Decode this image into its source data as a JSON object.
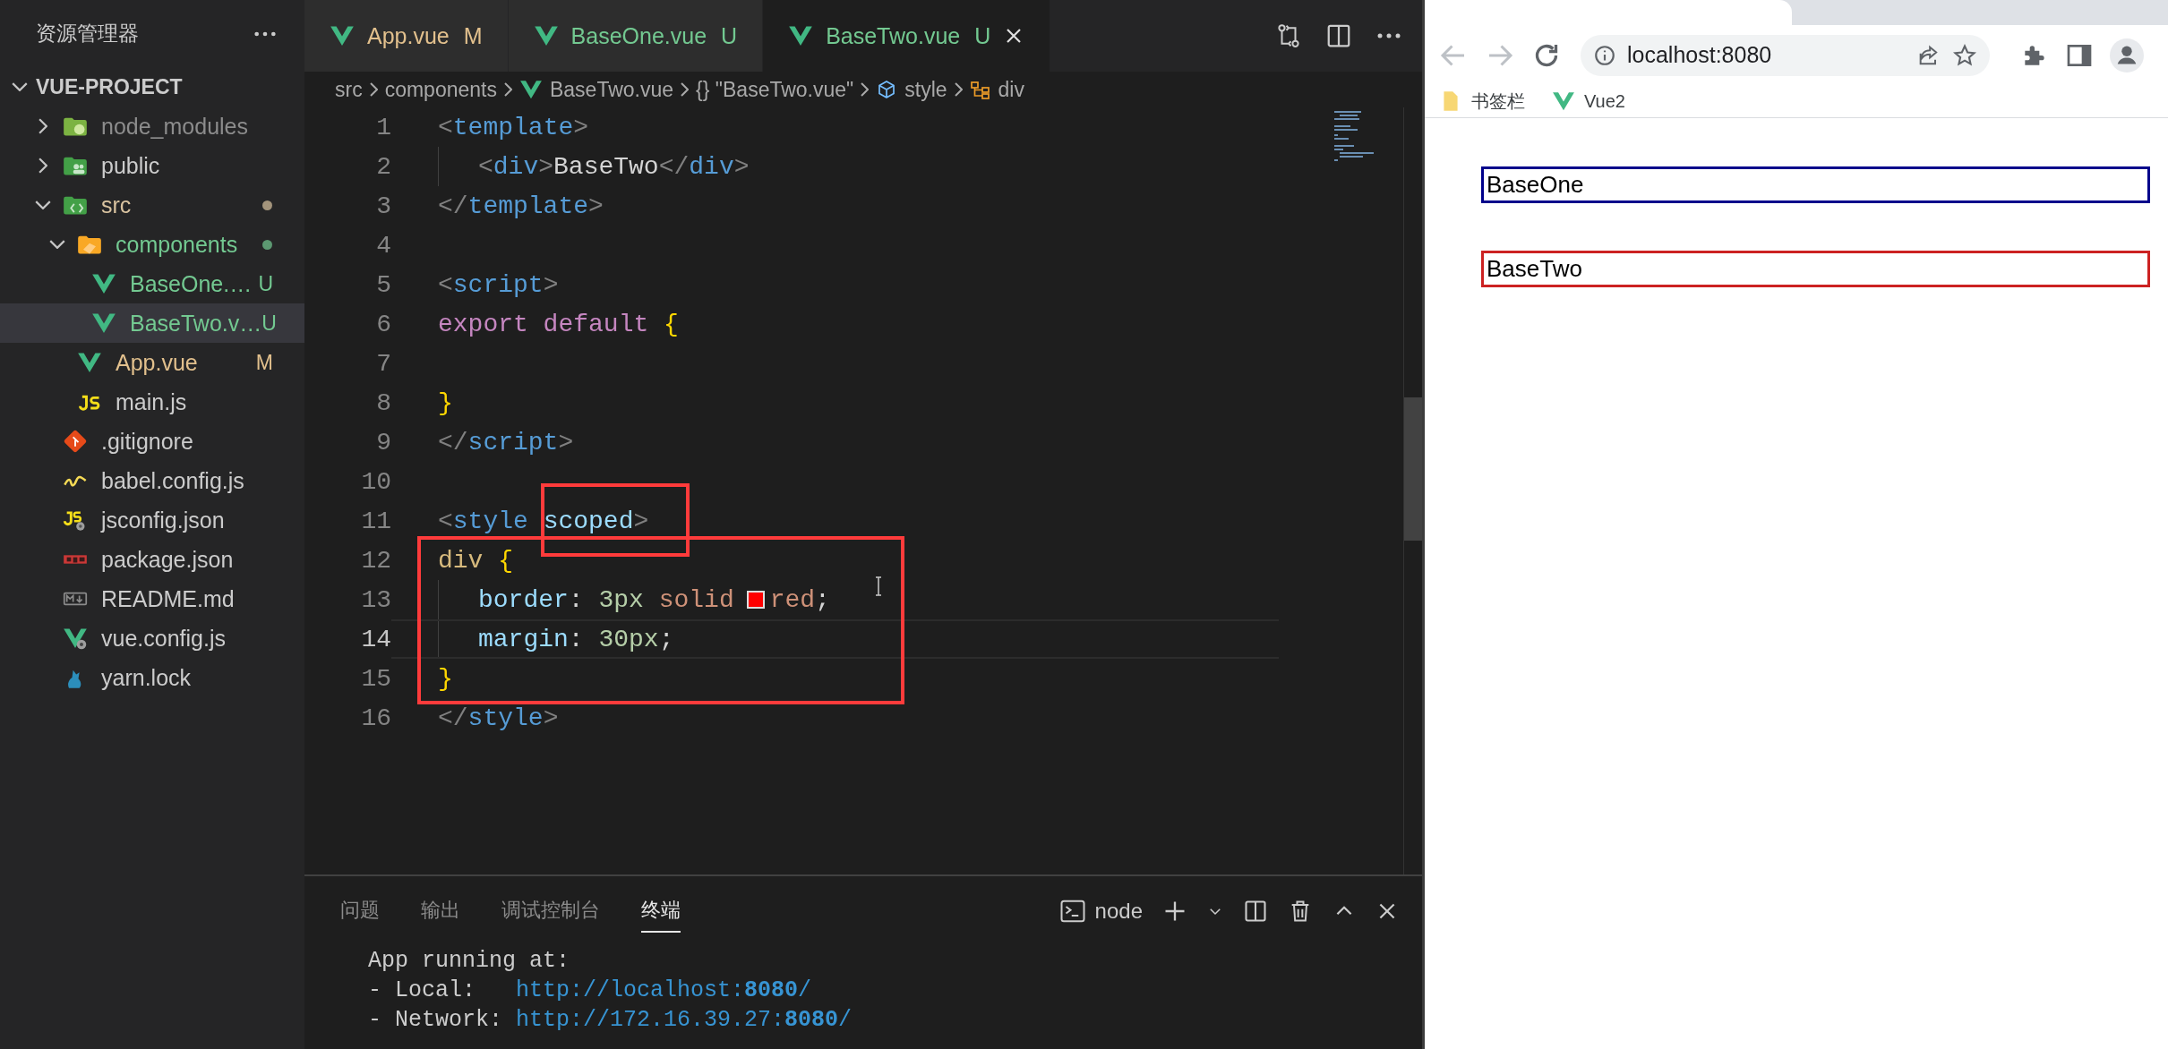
{
  "explorer": {
    "title": "资源管理器",
    "project": {
      "label": "VUE-PROJECT",
      "expanded": true
    },
    "tree": [
      {
        "label": "node_modules",
        "kind": "folder-js",
        "expanded": false,
        "selected": false,
        "dot": false,
        "color": "#8c8c8c"
      },
      {
        "label": "public",
        "kind": "folder-public",
        "expanded": false,
        "selected": false,
        "dot": false,
        "color": "#cccccc"
      },
      {
        "label": "src",
        "kind": "folder-src",
        "expanded": true,
        "selected": false,
        "dot": true,
        "color": "#d9c3a0",
        "children": [
          {
            "label": "components",
            "kind": "folder-components",
            "expanded": true,
            "selected": false,
            "dot": true,
            "color": "#73c991",
            "children": [
              {
                "label": "BaseOne.…",
                "kind": "vue",
                "selected": false,
                "dot": false,
                "badge": "U",
                "color": "#73c991"
              },
              {
                "label": "BaseTwo.v…",
                "kind": "vue",
                "selected": true,
                "dot": false,
                "badge": "U",
                "color": "#73c991"
              }
            ]
          },
          {
            "label": "App.vue",
            "kind": "vue",
            "selected": false,
            "dot": false,
            "badge": "M",
            "color": "#e2c08d"
          },
          {
            "label": "main.js",
            "kind": "js",
            "selected": false,
            "dot": false,
            "color": "#cccccc"
          }
        ]
      },
      {
        "label": ".gitignore",
        "kind": "git",
        "selected": false,
        "dot": false,
        "color": "#cccccc"
      },
      {
        "label": "babel.config.js",
        "kind": "babel",
        "selected": false,
        "dot": false,
        "color": "#cccccc"
      },
      {
        "label": "jsconfig.json",
        "kind": "jsconfig",
        "selected": false,
        "dot": false,
        "color": "#cccccc"
      },
      {
        "label": "package.json",
        "kind": "npm",
        "selected": false,
        "dot": false,
        "color": "#cccccc"
      },
      {
        "label": "README.md",
        "kind": "markdown",
        "selected": false,
        "dot": false,
        "color": "#cccccc"
      },
      {
        "label": "vue.config.js",
        "kind": "vueconfig",
        "selected": false,
        "dot": false,
        "color": "#cccccc"
      },
      {
        "label": "yarn.lock",
        "kind": "yarn",
        "selected": false,
        "dot": false,
        "color": "#cccccc"
      }
    ]
  },
  "editor": {
    "tabs": [
      {
        "label": "App.vue",
        "badge": "M",
        "color": "#e2c08d",
        "selected": false
      },
      {
        "label": "BaseOne.vue",
        "badge": "U",
        "color": "#73c991",
        "selected": false
      },
      {
        "label": "BaseTwo.vue",
        "badge": "U",
        "color": "#73c991",
        "selected": true
      }
    ],
    "breadcrumb": [
      {
        "label": "src",
        "kind": "text"
      },
      {
        "label": "components",
        "kind": "text"
      },
      {
        "label": "BaseTwo.vue",
        "kind": "vue"
      },
      {
        "label": "{} \"BaseTwo.vue\"",
        "kind": "text"
      },
      {
        "label": "style",
        "kind": "cube"
      },
      {
        "label": "div",
        "kind": "element"
      }
    ],
    "lines": [
      {
        "number": "1",
        "indented": false,
        "current": false,
        "tokens": [
          {
            "text": "<",
            "kind": "punct"
          },
          {
            "text": "template",
            "kind": "tag"
          },
          {
            "text": ">",
            "kind": "punct"
          }
        ]
      },
      {
        "number": "2",
        "indented": true,
        "current": false,
        "tokens": [
          {
            "text": "<",
            "kind": "punct"
          },
          {
            "text": "div",
            "kind": "tag"
          },
          {
            "text": ">",
            "kind": "punct"
          },
          {
            "text": "BaseTwo",
            "kind": "plain"
          },
          {
            "text": "</",
            "kind": "punct"
          },
          {
            "text": "div",
            "kind": "tag"
          },
          {
            "text": ">",
            "kind": "punct"
          }
        ]
      },
      {
        "number": "3",
        "indented": false,
        "current": false,
        "tokens": [
          {
            "text": "</",
            "kind": "punct"
          },
          {
            "text": "template",
            "kind": "tag"
          },
          {
            "text": ">",
            "kind": "punct"
          }
        ]
      },
      {
        "number": "4",
        "indented": false,
        "current": false
      },
      {
        "number": "5",
        "indented": false,
        "current": false,
        "tokens": [
          {
            "text": "<",
            "kind": "punct"
          },
          {
            "text": "script",
            "kind": "tag"
          },
          {
            "text": ">",
            "kind": "punct"
          }
        ]
      },
      {
        "number": "6",
        "indented": false,
        "current": false,
        "tokens": [
          {
            "text": "export default ",
            "kind": "keyword"
          },
          {
            "text": "{",
            "kind": "brace"
          }
        ]
      },
      {
        "number": "7",
        "indented": false,
        "current": false
      },
      {
        "number": "8",
        "indented": false,
        "current": false,
        "tokens": [
          {
            "text": "}",
            "kind": "brace"
          }
        ]
      },
      {
        "number": "9",
        "indented": false,
        "current": false,
        "tokens": [
          {
            "text": "</",
            "kind": "punct"
          },
          {
            "text": "script",
            "kind": "tag"
          },
          {
            "text": ">",
            "kind": "punct"
          }
        ]
      },
      {
        "number": "10",
        "indented": false,
        "current": false
      },
      {
        "number": "11",
        "indented": false,
        "current": false,
        "tokens": [
          {
            "text": "<",
            "kind": "punct"
          },
          {
            "text": "style ",
            "kind": "tag"
          },
          {
            "text": "scoped",
            "kind": "attr"
          },
          {
            "text": ">",
            "kind": "punct"
          }
        ]
      },
      {
        "number": "12",
        "indented": false,
        "current": false,
        "tokens": [
          {
            "text": "div ",
            "kind": "selector"
          },
          {
            "text": "{",
            "kind": "brace"
          }
        ]
      },
      {
        "number": "13",
        "indented": true,
        "current": false,
        "tokens": [
          {
            "text": "border",
            "kind": "property"
          },
          {
            "text": ": ",
            "kind": "plain"
          },
          {
            "text": "3",
            "kind": "number"
          },
          {
            "text": "px ",
            "kind": "number"
          },
          {
            "text": "solid",
            "kind": "value"
          },
          {
            "kind": "swatch",
            "color": "#ff0000"
          },
          {
            "text": "red",
            "kind": "value"
          },
          {
            "text": ";",
            "kind": "plain"
          }
        ]
      },
      {
        "number": "14",
        "indented": true,
        "current": true,
        "tokens": [
          {
            "text": "margin",
            "kind": "property"
          },
          {
            "text": ": ",
            "kind": "plain"
          },
          {
            "text": "30",
            "kind": "number"
          },
          {
            "text": "px",
            "kind": "number"
          },
          {
            "text": ";",
            "kind": "plain"
          }
        ]
      },
      {
        "number": "15",
        "indented": false,
        "current": false,
        "tokens": [
          {
            "text": "}",
            "kind": "brace"
          }
        ]
      },
      {
        "number": "16",
        "indented": false,
        "current": false,
        "tokens": [
          {
            "text": "</",
            "kind": "punct"
          },
          {
            "text": "style",
            "kind": "tag"
          },
          {
            "text": ">",
            "kind": "punct"
          }
        ]
      }
    ],
    "annotations": [
      {
        "kind": "rectangle"
      },
      {
        "kind": "rectangle"
      }
    ]
  },
  "panel": {
    "tabs": [
      {
        "label": "问题",
        "selected": false
      },
      {
        "label": "输出",
        "selected": false
      },
      {
        "label": "调试控制台",
        "selected": false
      },
      {
        "label": "终端",
        "selected": true
      }
    ],
    "terminal_name": "node",
    "lines": [
      {
        "text": "App running at:"
      },
      {
        "text": "- Local:",
        "link": "http://localhost:**8080**/"
      },
      {
        "text": "- Network:",
        "link": "http://172.16.39.27:**8080**/"
      }
    ]
  },
  "browser": {
    "nav": [
      {
        "kind": "back",
        "disabled": true
      },
      {
        "kind": "forward",
        "disabled": true
      },
      {
        "kind": "reload",
        "disabled": false
      }
    ],
    "address": "localhost:8080",
    "bookmarks": [
      {
        "label": "书签栏",
        "kind": "folder"
      },
      {
        "label": "Vue2",
        "kind": "vue"
      }
    ],
    "boxes": [
      {
        "text": "BaseOne",
        "color": "#00008b"
      },
      {
        "text": "BaseTwo",
        "color": "#cc2222"
      }
    ]
  }
}
